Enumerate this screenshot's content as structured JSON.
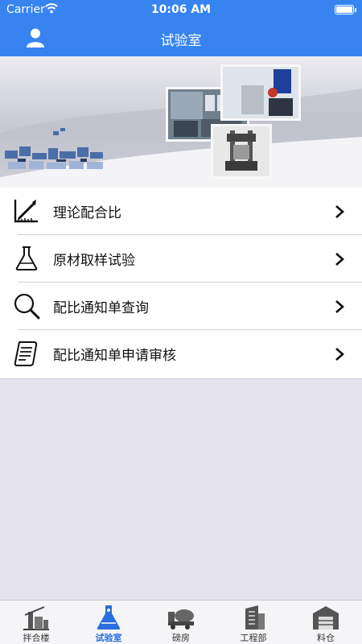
{
  "status_bar": {
    "carrier": "Carrier",
    "time": "10:06 AM"
  },
  "nav": {
    "title": "试验室",
    "profile_icon": "user-icon"
  },
  "menu": {
    "items": [
      {
        "label": "理论配合比",
        "icon": "ruler-pen-icon"
      },
      {
        "label": "原材取样试验",
        "icon": "flask-icon"
      },
      {
        "label": "配比通知单查询",
        "icon": "search-icon"
      },
      {
        "label": "配比通知单申请审核",
        "icon": "document-review-icon"
      }
    ]
  },
  "tabbar": {
    "active": "试验室",
    "accent_color": "#2a6ee0",
    "tabs": [
      {
        "label": "拌合楼",
        "icon": "mixing-plant-icon"
      },
      {
        "label": "试验室",
        "icon": "lab-flask-icon"
      },
      {
        "label": "磅房",
        "icon": "truck-scale-icon"
      },
      {
        "label": "工程部",
        "icon": "building-icon"
      },
      {
        "label": "料仓",
        "icon": "warehouse-icon"
      }
    ]
  },
  "colors": {
    "header": "#3784f0",
    "background": "#e3e2ee"
  }
}
